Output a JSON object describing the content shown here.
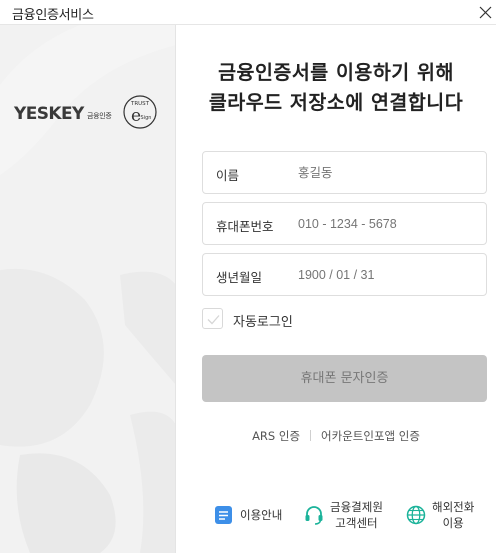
{
  "window": {
    "title": "금융인증서비스",
    "close_icon": "close-icon"
  },
  "brand": {
    "name": "YESKEY",
    "subtitle": "금융인증",
    "seal_top": "TRUST",
    "seal_mid": "e",
    "seal_bottom": "Sign"
  },
  "heading": {
    "line1": "금융인증서를 이용하기 위해",
    "line2": "클라우드 저장소에 연결합니다"
  },
  "form": {
    "name_label": "이름",
    "name_placeholder": "홍길동",
    "phone_label": "휴대폰번호",
    "phone_placeholder": "010 - 1234 - 5678",
    "birth_label": "생년월일",
    "birth_placeholder": "1900 / 01 / 31",
    "autologin_label": "자동로그인",
    "autologin_checked": false,
    "submit_label": "휴대폰 문자인증"
  },
  "alt_links": {
    "ars": "ARS 인증",
    "app": "어카운트인포앱 인증"
  },
  "footer": {
    "guide": {
      "label": "이용안내",
      "icon": "document-icon",
      "color": "#3d8fe8"
    },
    "support": {
      "line1": "금융결제원",
      "line2": "고객센터",
      "icon": "headset-icon",
      "color": "#1bb39a"
    },
    "overseas": {
      "line1": "해외전화",
      "line2": "이용",
      "icon": "globe-icon",
      "color": "#1bb39a"
    }
  },
  "colors": {
    "button_disabled": "#c4c4c4",
    "left_panel": "#f2f2f2"
  }
}
